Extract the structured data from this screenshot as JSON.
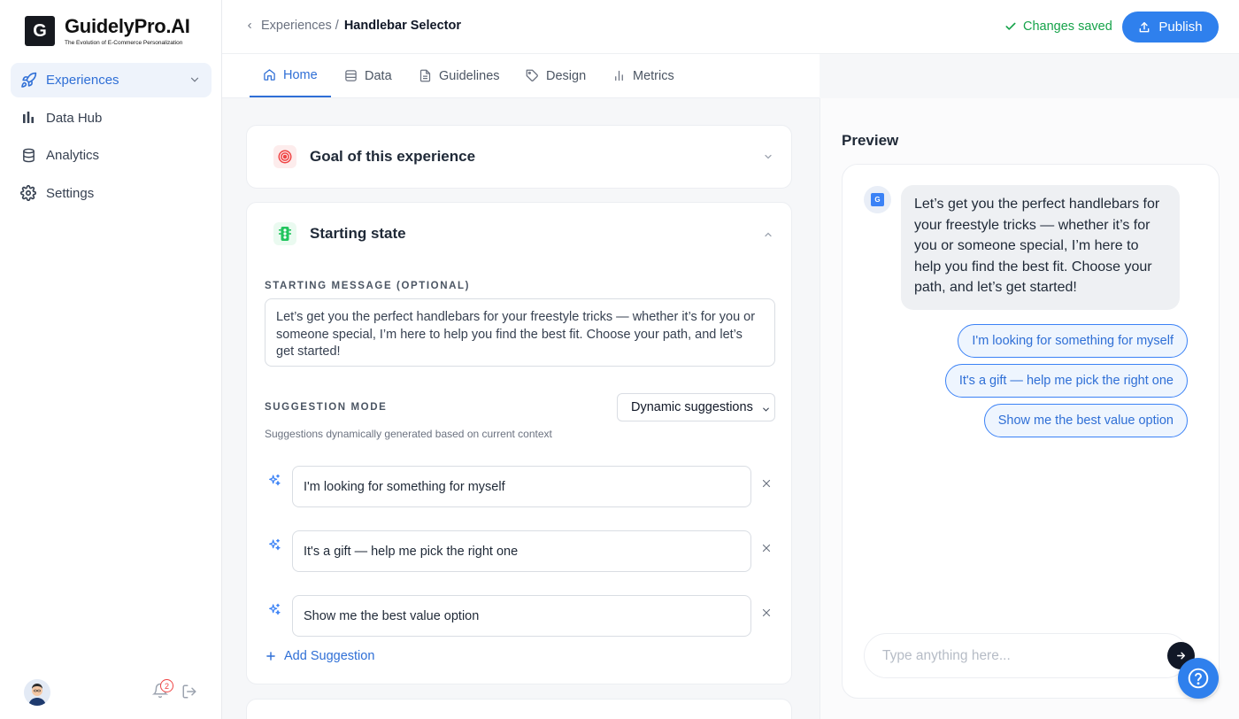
{
  "brand": {
    "mark": "G",
    "name": "GuidelyPro.AI",
    "tagline": "The Evolution of E-Commerce Personalization"
  },
  "sidebar": {
    "items": [
      {
        "label": "Experiences",
        "icon": "rocket-icon",
        "active": true
      },
      {
        "label": "Data Hub",
        "icon": "bar-chart-icon"
      },
      {
        "label": "Analytics",
        "icon": "database-icon"
      },
      {
        "label": "Settings",
        "icon": "gear-icon"
      }
    ],
    "notification_count": "2"
  },
  "header": {
    "breadcrumb_prev": "Experiences",
    "breadcrumb_sep": "/",
    "breadcrumb_current": "Handlebar Selector",
    "status": "Changes saved",
    "publish_label": "Publish"
  },
  "tabs": [
    {
      "label": "Home",
      "icon": "home-icon",
      "active": true
    },
    {
      "label": "Data",
      "icon": "database-icon"
    },
    {
      "label": "Guidelines",
      "icon": "document-icon"
    },
    {
      "label": "Design",
      "icon": "tag-icon"
    },
    {
      "label": "Metrics",
      "icon": "bar-chart-icon"
    }
  ],
  "goal_card": {
    "title": "Goal of this experience"
  },
  "starting_state": {
    "title": "Starting state",
    "message_label": "STARTING MESSAGE (OPTIONAL)",
    "message": "Let’s get you the perfect handlebars for your freestyle tricks — whether it’s for you or someone special, I’m here to help you find the best fit. Choose your path, and let’s get started!",
    "mode_label": "SUGGESTION MODE",
    "mode_value": "Dynamic suggestions",
    "mode_helper": "Suggestions dynamically generated based on current context",
    "suggestions": [
      "I'm looking for something for myself",
      "It's a gift — help me pick the right one",
      "Show me the best value option"
    ],
    "add_label": "Add Suggestion"
  },
  "preview": {
    "title": "Preview",
    "bot_avatar": "G",
    "bot_message": "Let’s get you the perfect handlebars for your freestyle tricks — whether it’s for you or someone special, I’m here to help you find the best fit. Choose your path, and let’s get started!",
    "chips": [
      "I'm looking for something for myself",
      "It's a gift — help me pick the right one",
      "Show me the best value option"
    ],
    "input_placeholder": "Type anything here..."
  },
  "colors": {
    "accent": "#2f80ed",
    "success": "#16a34a",
    "goal_icon": "#ef4444",
    "state_icon": "#22c55e"
  }
}
